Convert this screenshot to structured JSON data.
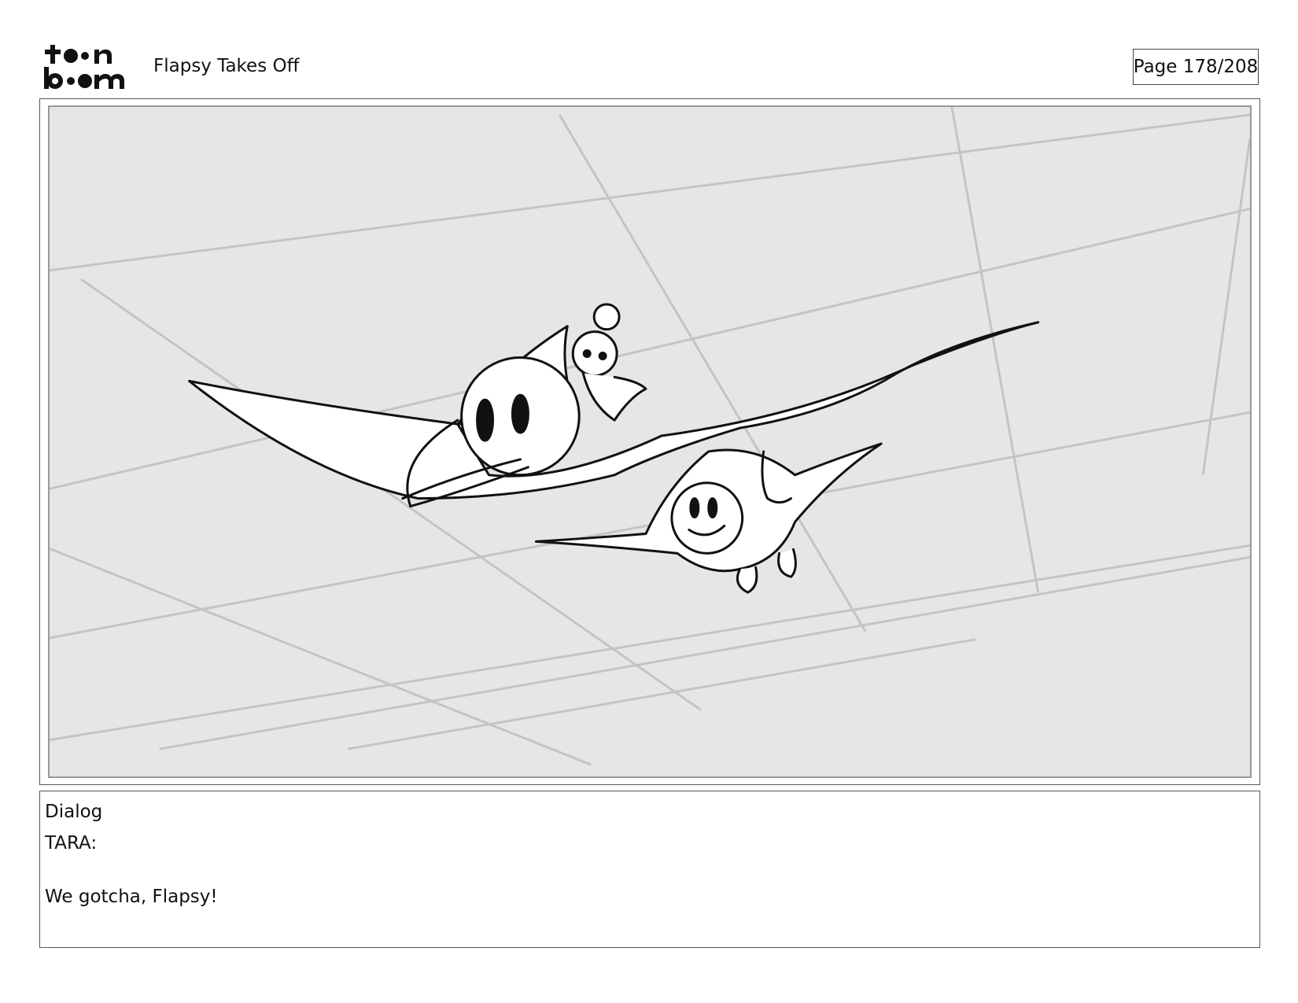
{
  "header": {
    "logo_text": "toon boom",
    "project_title": "Flapsy Takes Off",
    "page_indicator": "Page 178/208"
  },
  "panel": {
    "background_color": "#e6e6e6",
    "sketch_stroke_color": "#111111",
    "perspective_grid_color": "#c4c4c4"
  },
  "dialog": {
    "heading": "Dialog",
    "speaker": "TARA:",
    "line": "We gotcha, Flapsy!"
  }
}
